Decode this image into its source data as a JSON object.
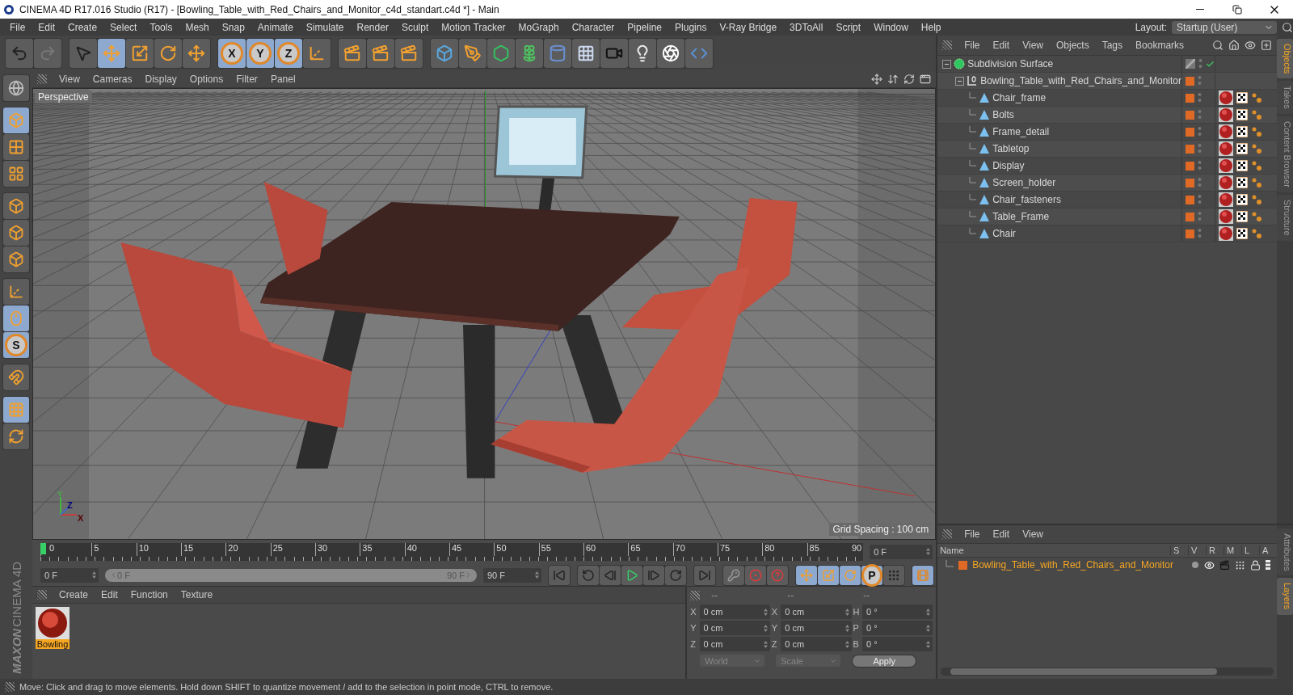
{
  "window": {
    "title": "CINEMA 4D R17.016 Studio (R17) - [Bowling_Table_with_Red_Chairs_and_Monitor_c4d_standart.c4d *] - Main"
  },
  "menu": [
    "File",
    "Edit",
    "Create",
    "Select",
    "Tools",
    "Mesh",
    "Snap",
    "Animate",
    "Simulate",
    "Render",
    "Sculpt",
    "Motion Tracker",
    "MoGraph",
    "Character",
    "Pipeline",
    "Plugins",
    "V-Ray Bridge",
    "3DToAll",
    "Script",
    "Window",
    "Help"
  ],
  "layout": {
    "label": "Layout:",
    "value": "Startup (User)"
  },
  "toolbar": [
    [
      {
        "kind": "undo",
        "selected": false
      },
      {
        "kind": "redo",
        "selected": false
      }
    ],
    [
      {
        "kind": "select",
        "selected": false
      },
      {
        "kind": "move",
        "selected": true
      },
      {
        "kind": "scale",
        "selected": false
      },
      {
        "kind": "rotate",
        "selected": false
      },
      {
        "kind": "transform",
        "selected": false
      }
    ],
    [
      {
        "kind": "axis",
        "label": "X",
        "selected": true
      },
      {
        "kind": "axis",
        "label": "Y",
        "selected": true
      },
      {
        "kind": "axis",
        "label": "Z",
        "selected": true
      },
      {
        "kind": "coord",
        "selected": false
      }
    ],
    [
      {
        "kind": "render-view",
        "selected": false
      },
      {
        "kind": "render",
        "selected": false
      },
      {
        "kind": "render-settings",
        "selected": false
      }
    ],
    [
      {
        "kind": "cube",
        "selected": false
      },
      {
        "kind": "pen",
        "selected": false
      },
      {
        "kind": "subdivision",
        "selected": false
      },
      {
        "kind": "cloner",
        "selected": false
      },
      {
        "kind": "deformer",
        "selected": false
      },
      {
        "kind": "floor",
        "selected": false
      },
      {
        "kind": "camera",
        "selected": false
      },
      {
        "kind": "light",
        "selected": false
      },
      {
        "kind": "sketch",
        "selected": false
      },
      {
        "kind": "python",
        "selected": false
      }
    ]
  ],
  "left_toolbar": [
    [
      {
        "kind": "editable",
        "selected": false
      }
    ],
    [
      {
        "kind": "model",
        "selected": true
      },
      {
        "kind": "texture",
        "selected": false
      },
      {
        "kind": "workplane",
        "selected": false
      }
    ],
    [
      {
        "kind": "points",
        "selected": false
      },
      {
        "kind": "edges",
        "selected": false
      },
      {
        "kind": "polygons",
        "selected": false
      }
    ],
    [
      {
        "kind": "axis-mode",
        "selected": false
      },
      {
        "kind": "tweak",
        "selected": true
      },
      {
        "kind": "snap",
        "label": "S",
        "selected": true
      }
    ],
    [
      {
        "kind": "magnet",
        "selected": false
      }
    ],
    [
      {
        "kind": "grid-lock",
        "selected": true
      },
      {
        "kind": "grid-rotate",
        "selected": false
      }
    ]
  ],
  "logo": {
    "brand": "MAXON",
    "product": "CINEMA 4D"
  },
  "viewport": {
    "menu": [
      "View",
      "Cameras",
      "Display",
      "Options",
      "Filter",
      "Panel"
    ],
    "camera": "Perspective",
    "grid_spacing": "Grid Spacing : 100 cm",
    "axis_labels": [
      "Y",
      "Z",
      "X"
    ]
  },
  "objects": {
    "menu": [
      "File",
      "Edit",
      "View",
      "Objects",
      "Tags",
      "Bookmarks"
    ],
    "tree": [
      {
        "name": "Subdivision Surface",
        "kind": "subdivision",
        "enabled": true,
        "expanded": true,
        "children": [
          {
            "name": "Bowling_Table_with_Red_Chairs_and_Monitor",
            "kind": "null",
            "color": "#e06a25",
            "expanded": true,
            "children": [
              {
                "name": "Chair_frame",
                "kind": "polygon",
                "color": "#e06a25",
                "tags": [
                  {
                    "kind": "material"
                  },
                  {
                    "kind": "texture"
                  },
                  {
                    "kind": "uvw"
                  }
                ]
              },
              {
                "name": "Bolts",
                "kind": "polygon",
                "color": "#e06a25",
                "tags": [
                  {
                    "kind": "material"
                  },
                  {
                    "kind": "texture"
                  },
                  {
                    "kind": "uvw"
                  }
                ]
              },
              {
                "name": "Frame_detail",
                "kind": "polygon",
                "color": "#e06a25",
                "tags": [
                  {
                    "kind": "material"
                  },
                  {
                    "kind": "texture"
                  },
                  {
                    "kind": "uvw"
                  }
                ]
              },
              {
                "name": "Tabletop",
                "kind": "polygon",
                "color": "#e06a25",
                "tags": [
                  {
                    "kind": "material"
                  },
                  {
                    "kind": "texture"
                  },
                  {
                    "kind": "uvw"
                  }
                ]
              },
              {
                "name": "Display",
                "kind": "polygon",
                "color": "#e06a25",
                "tags": [
                  {
                    "kind": "material"
                  },
                  {
                    "kind": "texture"
                  },
                  {
                    "kind": "uvw"
                  }
                ]
              },
              {
                "name": "Screen_holder",
                "kind": "polygon",
                "color": "#e06a25",
                "tags": [
                  {
                    "kind": "material"
                  },
                  {
                    "kind": "texture"
                  },
                  {
                    "kind": "uvw"
                  }
                ]
              },
              {
                "name": "Chair_fasteners",
                "kind": "polygon",
                "color": "#e06a25",
                "tags": [
                  {
                    "kind": "material"
                  },
                  {
                    "kind": "texture"
                  },
                  {
                    "kind": "uvw"
                  }
                ]
              },
              {
                "name": "Table_Frame",
                "kind": "polygon",
                "color": "#e06a25",
                "tags": [
                  {
                    "kind": "material"
                  },
                  {
                    "kind": "texture"
                  },
                  {
                    "kind": "uvw"
                  }
                ]
              },
              {
                "name": "Chair",
                "kind": "polygon",
                "color": "#e06a25",
                "tags": [
                  {
                    "kind": "material"
                  },
                  {
                    "kind": "texture"
                  },
                  {
                    "kind": "uvw"
                  }
                ]
              }
            ]
          }
        ]
      }
    ]
  },
  "side_tabs_top": [
    {
      "label": "Objects",
      "selected": true
    },
    {
      "label": "Takes",
      "selected": false
    },
    {
      "label": "Content Browser",
      "selected": false
    },
    {
      "label": "Structure",
      "selected": false
    }
  ],
  "timeline": {
    "ticks": [
      "0",
      "5",
      "10",
      "15",
      "20",
      "25",
      "30",
      "35",
      "40",
      "45",
      "50",
      "55",
      "60",
      "65",
      "70",
      "75",
      "80",
      "85",
      "90"
    ],
    "level": 0,
    "current": "0 F"
  },
  "range": {
    "start": "0 F",
    "slider_start": "0 F",
    "slider_end": "90 F",
    "end": "90 F"
  },
  "playback": [
    [
      {
        "kind": "first",
        "selected": false
      }
    ],
    [
      {
        "kind": "prev-key",
        "selected": false
      },
      {
        "kind": "prev-frame",
        "selected": false
      },
      {
        "kind": "play",
        "selected": false
      },
      {
        "kind": "next-frame",
        "selected": false
      },
      {
        "kind": "next-key",
        "selected": false
      }
    ],
    [
      {
        "kind": "last",
        "selected": false
      }
    ],
    [
      {
        "kind": "key",
        "selected": false
      },
      {
        "kind": "record",
        "selected": false
      },
      {
        "kind": "auto-key",
        "selected": false
      }
    ],
    [
      {
        "kind": "key-move",
        "selected": true
      },
      {
        "kind": "key-scale",
        "selected": true
      },
      {
        "kind": "key-rotate",
        "selected": true
      },
      {
        "kind": "key-param",
        "label": "P",
        "selected": true
      },
      {
        "kind": "key-points",
        "selected": false
      }
    ],
    [
      {
        "kind": "timeline",
        "selected": true
      }
    ]
  ],
  "materials": {
    "menu": [
      "Create",
      "Edit",
      "Function",
      "Texture"
    ],
    "items": [
      {
        "name": "Bowling",
        "selected": true
      }
    ]
  },
  "coordinates": {
    "headers": [
      "--",
      "--",
      "--"
    ],
    "rows": [
      [
        {
          "label": "X",
          "value": "0 cm"
        },
        {
          "label": "X",
          "value": "0 cm"
        },
        {
          "label": "H",
          "value": "0 °"
        }
      ],
      [
        {
          "label": "Y",
          "value": "0 cm"
        },
        {
          "label": "Y",
          "value": "0 cm"
        },
        {
          "label": "P",
          "value": "0 °"
        }
      ],
      [
        {
          "label": "Z",
          "value": "0 cm"
        },
        {
          "label": "Z",
          "value": "0 cm"
        },
        {
          "label": "B",
          "value": "0 °"
        }
      ]
    ],
    "dropdowns": [
      "World",
      "Scale"
    ],
    "apply": "Apply"
  },
  "layers": {
    "menu": [
      "File",
      "Edit",
      "View"
    ],
    "columns": [
      "Name",
      "S",
      "V",
      "R",
      "M",
      "L",
      "A"
    ],
    "rows": [
      {
        "name": "Bowling_Table_with_Red_Chairs_and_Monitor",
        "color": "#e06a25"
      }
    ]
  },
  "side_tabs_bottom": [
    {
      "label": "Attributes",
      "selected": false
    },
    {
      "label": "Layers",
      "selected": true
    }
  ],
  "status": "Move: Click and drag to move elements. Hold down SHIFT to quantize movement / add to the selection in point mode, CTRL to remove."
}
